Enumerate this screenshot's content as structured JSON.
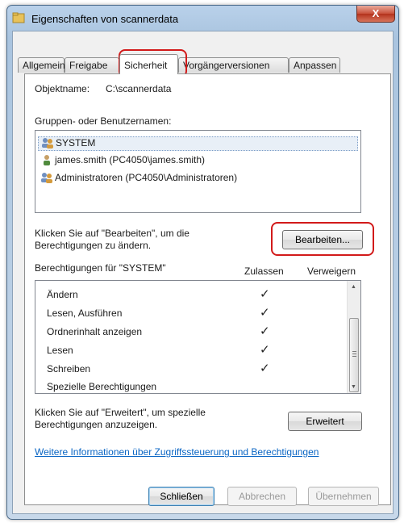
{
  "window": {
    "title": "Eigenschaften von scannerdata",
    "close_label": "X"
  },
  "tabs": [
    {
      "label": "Allgemein"
    },
    {
      "label": "Freigabe"
    },
    {
      "label": "Sicherheit"
    },
    {
      "label": "Vorgängerversionen"
    },
    {
      "label": "Anpassen"
    }
  ],
  "security": {
    "object_label": "Objektname:",
    "object_value": "C:\\scannerdata",
    "groups_label": "Gruppen- oder Benutzernamen:",
    "groups": [
      {
        "name": "SYSTEM",
        "icon": "users-group-icon"
      },
      {
        "name": "james.smith (PC4050\\james.smith)",
        "icon": "user-icon"
      },
      {
        "name": "Administratoren (PC4050\\Administratoren)",
        "icon": "users-group-icon"
      }
    ],
    "edit_hint_line1": "Klicken Sie auf \"Bearbeiten\", um die",
    "edit_hint_line2": "Berechtigungen zu ändern.",
    "edit_button": "Bearbeiten...",
    "permissions_label": "Berechtigungen für \"SYSTEM\"",
    "col_allow": "Zulassen",
    "col_deny": "Verweigern",
    "permissions": [
      {
        "name": "Ändern",
        "allow": "✓",
        "deny": ""
      },
      {
        "name": "Lesen, Ausführen",
        "allow": "✓",
        "deny": ""
      },
      {
        "name": "Ordnerinhalt anzeigen",
        "allow": "✓",
        "deny": ""
      },
      {
        "name": "Lesen",
        "allow": "✓",
        "deny": ""
      },
      {
        "name": "Schreiben",
        "allow": "✓",
        "deny": ""
      },
      {
        "name": "Spezielle Berechtigungen",
        "allow": "",
        "deny": ""
      }
    ],
    "advanced_hint_line1": "Klicken Sie auf \"Erweitert\", um spezielle",
    "advanced_hint_line2": "Berechtigungen anzuzeigen.",
    "advanced_button": "Erweitert",
    "info_link": "Weitere Informationen über Zugriffssteuerung und Berechtigungen"
  },
  "footer": {
    "close_button": "Schließen",
    "cancel_button": "Abbrechen",
    "apply_button": "Übernehmen"
  },
  "colors": {
    "highlight": "#d21a1a",
    "link": "#0b66c4",
    "title_gradient": "#b9d1ea"
  }
}
